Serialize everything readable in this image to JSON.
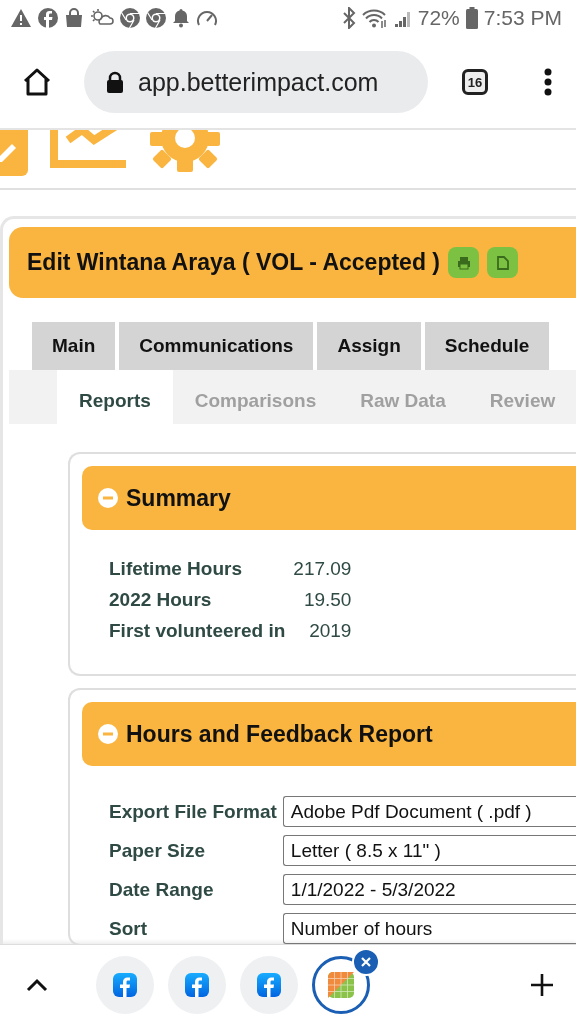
{
  "status_bar": {
    "battery": "72%",
    "time": "7:53 PM"
  },
  "browser": {
    "url": "app.betterimpact.com",
    "tab_count": "16"
  },
  "page": {
    "title": "Edit Wintana Araya ( VOL - Accepted )",
    "tabs": [
      {
        "label": "Main",
        "selected": false
      },
      {
        "label": "Communications",
        "selected": false
      },
      {
        "label": "Assign",
        "selected": false
      },
      {
        "label": "Schedule",
        "selected": false
      }
    ],
    "subtabs": [
      {
        "label": "Reports",
        "selected": true
      },
      {
        "label": "Comparisons",
        "selected": false
      },
      {
        "label": "Raw Data",
        "selected": false
      },
      {
        "label": "Review",
        "selected": false
      }
    ],
    "summary": {
      "title": "Summary",
      "expanded": true,
      "rows": [
        {
          "label": "Lifetime Hours",
          "value": "217.09"
        },
        {
          "label": "2022 Hours",
          "value": "19.50"
        },
        {
          "label": "First volunteered in",
          "value": "2019"
        }
      ]
    },
    "report": {
      "title": "Hours and Feedback Report",
      "expanded": true,
      "fields": [
        {
          "label": "Export File Format",
          "value": "Adobe Pdf Document ( .pdf )"
        },
        {
          "label": "Paper Size",
          "value": "Letter ( 8.5 x 11\" )"
        },
        {
          "label": "Date Range",
          "value": "1/1/2022 - 5/3/2022"
        },
        {
          "label": "Sort",
          "value": "Number of hours"
        }
      ]
    }
  },
  "tab_strip": [
    {
      "kind": "facebook",
      "selected": false
    },
    {
      "kind": "facebook",
      "selected": false
    },
    {
      "kind": "facebook",
      "selected": false
    },
    {
      "kind": "sheet",
      "selected": true
    }
  ]
}
